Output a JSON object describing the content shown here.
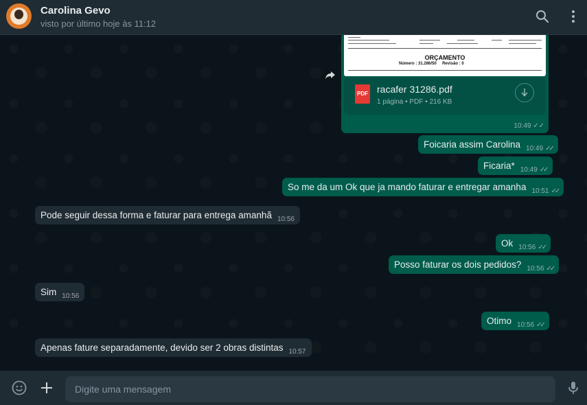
{
  "header": {
    "contact_name": "Carolina Gevo",
    "status": "visto por último hoje às 11:12"
  },
  "document": {
    "preview_title": "ORÇAMENTO",
    "preview_number_label": "Número :",
    "preview_number": "31.286/50",
    "preview_revision_label": "Revisão :",
    "preview_revision": "0",
    "file_icon_label": "PDF",
    "file_name": "racafer 31286.pdf",
    "file_meta": "1 página • PDF • 216 KB",
    "time": "10:49"
  },
  "messages": [
    {
      "direction": "out",
      "text": "Foicaria assim Carolina",
      "time": "10:49"
    },
    {
      "direction": "out",
      "text": "Ficaria*",
      "time": "10:49"
    },
    {
      "direction": "out",
      "text": "So me da um Ok que ja mando faturar e entregar amanha",
      "time": "10:51"
    },
    {
      "direction": "in",
      "text": "Pode seguir dessa forma e faturar para entrega amanhã",
      "time": "10:56"
    },
    {
      "direction": "out",
      "text": "Ok",
      "time": "10:56"
    },
    {
      "direction": "out",
      "text": "Posso faturar os dois pedidos?",
      "time": "10:56"
    },
    {
      "direction": "in",
      "text": "Sim",
      "time": "10:56"
    },
    {
      "direction": "out",
      "text": "Otimo",
      "time": "10:56"
    },
    {
      "direction": "in",
      "text": "Apenas fature separadamente, devido ser 2 obras distintas",
      "time": "10:57"
    }
  ],
  "footer": {
    "placeholder": "Digite uma mensagem"
  },
  "icons": {
    "search": "search-icon",
    "menu": "kebab-menu-icon",
    "emoji": "emoji-icon",
    "attach": "plus-icon",
    "mic": "microphone-icon",
    "forward": "forward-icon",
    "download": "download-icon",
    "read_receipt": "double-check-icon"
  },
  "colors": {
    "outgoing_bubble": "#005c4b",
    "incoming_bubble": "#202c33",
    "background": "#0b141a",
    "header": "#202c33",
    "pdf_red": "#e53935"
  }
}
